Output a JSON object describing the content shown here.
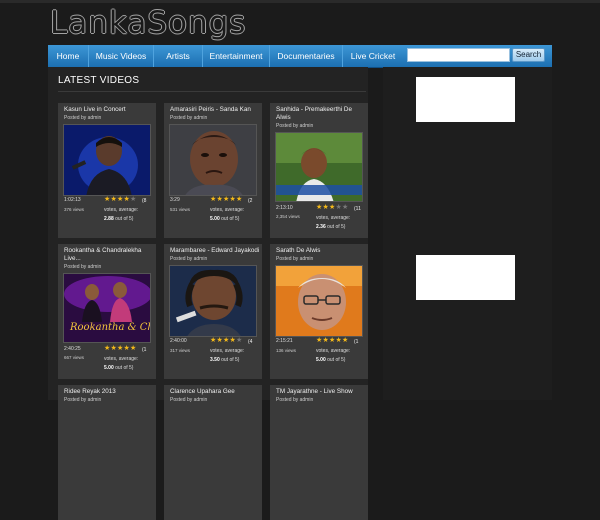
{
  "site": {
    "logo": "LankaSongs"
  },
  "nav": {
    "items": [
      "Home",
      "Music Videos",
      "Artists",
      "Entertainment",
      "Documentaries",
      "Live Cricket"
    ],
    "search_placeholder": "",
    "search_button": "Search"
  },
  "section": {
    "title": "LATEST VIDEOS"
  },
  "videos": [
    {
      "title": "Kasun Live in Concert",
      "posted": "Posted by admin",
      "duration": "1:02:13",
      "views": "376 views",
      "rating_stars": 4,
      "votes": "(8",
      "votes_label": "votes, average:",
      "average": "2.88",
      "out_of": "out of 5)"
    },
    {
      "title": "Amarasiri Peiris - Sanda Kan",
      "posted": "Posted by admin",
      "duration": "3:29",
      "views": "531 views",
      "rating_stars": 5,
      "votes": "(2",
      "votes_label": "votes, average:",
      "average": "5.00",
      "out_of": "out of 5)"
    },
    {
      "title": "Sanhida - Premakeerthi De Alwis",
      "posted": "Posted by admin",
      "duration": "2:13:10",
      "views": "2,354 views",
      "rating_stars": 3,
      "votes": "(11",
      "votes_label": "votes, average:",
      "average": "2.36",
      "out_of": "out of 5)"
    },
    {
      "title": "Rookantha & Chandralekha Live...",
      "posted": "Posted by admin",
      "duration": "2:40:25",
      "views": "667 views",
      "rating_stars": 5,
      "votes": "(1",
      "votes_label": "votes, average:",
      "average": "5.00",
      "out_of": "out of 5)"
    },
    {
      "title": "Marambaree - Edward Jayakodi",
      "posted": "Posted by admin",
      "duration": "2:40:00",
      "views": "317 views",
      "rating_stars": 4,
      "votes": "(4",
      "votes_label": "votes, average:",
      "average": "3.50",
      "out_of": "out of 5)"
    },
    {
      "title": "Sarath De Alwis",
      "posted": "Posted by admin",
      "duration": "2:15:21",
      "views": "136 views",
      "rating_stars": 5,
      "votes": "(1",
      "votes_label": "votes, average:",
      "average": "5.00",
      "out_of": "out of 5)"
    },
    {
      "title": "Ridee Reyak 2013",
      "posted": "Posted by admin"
    },
    {
      "title": "Clarence Upahara Gee",
      "posted": "Posted by admin"
    },
    {
      "title": "TM Jayarathne - Live Show",
      "posted": "Posted by admin"
    }
  ],
  "thumb_captions": {
    "rookantha": "Rookantha & Chandralekha"
  },
  "colors": {
    "nav": "#1f78bd",
    "star": "#f3b81a",
    "card": "#3a3a3a"
  },
  "icons": {
    "rating": "star-icon"
  }
}
